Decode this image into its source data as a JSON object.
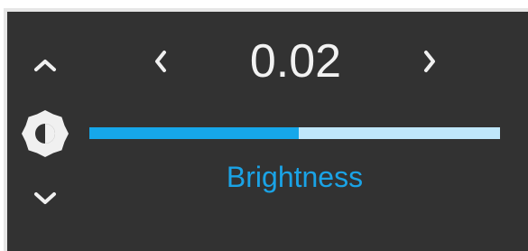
{
  "control": {
    "value": "0.02",
    "label": "Brightness",
    "slider_level": 0.51
  },
  "icons": {
    "up": "chevron-up-icon",
    "down": "chevron-down-icon",
    "prev": "chevron-left-icon",
    "next": "chevron-right-icon",
    "setting": "brightness-icon"
  },
  "colors": {
    "panel_bg": "#323232",
    "text": "#f2f2f2",
    "accent": "#16a7ea",
    "track": "#bfe7fb",
    "label": "#1aa3e6",
    "icon": "#f0f0f0"
  }
}
